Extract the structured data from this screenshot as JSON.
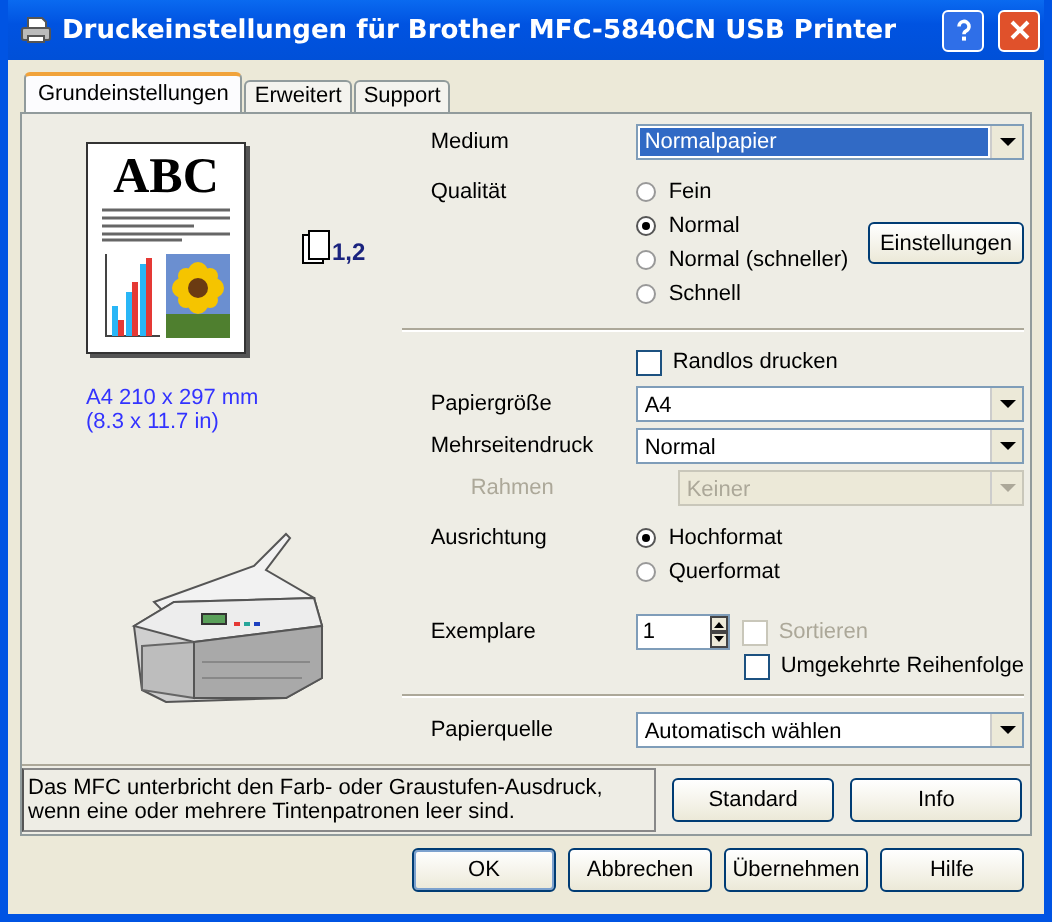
{
  "window": {
    "title": "Druckeinstellungen für Brother MFC-5840CN USB Printer"
  },
  "tabs": [
    {
      "label": "Grundeinstellungen",
      "selected": true
    },
    {
      "label": "Erweitert",
      "selected": false
    },
    {
      "label": "Support",
      "selected": false
    }
  ],
  "preview": {
    "heading": "ABC",
    "copies": "1,2",
    "paper_size": [
      "A4 210 x 297 mm",
      "(8.3 x 11.7 in)"
    ]
  },
  "settings": [
    {
      "kind": "dropdown",
      "label": "Medium",
      "value": "Normalpapier",
      "selected": true,
      "disabled": false
    },
    {
      "kind": "radios",
      "label": "Qualität",
      "options": [
        {
          "label": "Fein",
          "selected": false
        },
        {
          "label": "Normal",
          "selected": true
        },
        {
          "label": "Normal (schneller)",
          "selected": false
        },
        {
          "label": "Schnell",
          "selected": false
        }
      ],
      "button": "Einstellungen"
    },
    {
      "kind": "separator"
    },
    {
      "kind": "checkbox",
      "label": "Randlos drucken",
      "checked": false
    },
    {
      "kind": "dropdown",
      "label": "Papiergröße",
      "value": "A4",
      "selected": false,
      "disabled": false
    },
    {
      "kind": "dropdown",
      "label": "Mehrseitendruck",
      "value": "Normal",
      "selected": false,
      "disabled": false
    },
    {
      "kind": "dropdown",
      "label": "Rahmen",
      "value": "Keiner",
      "selected": false,
      "disabled": true
    },
    {
      "kind": "radios",
      "label": "Ausrichtung",
      "options": [
        {
          "label": "Hochformat",
          "selected": true
        },
        {
          "label": "Querformat",
          "selected": false
        }
      ]
    },
    {
      "kind": "copies",
      "label": "Exemplare",
      "value": "1",
      "sort": {
        "label": "Sortieren",
        "checked": false,
        "disabled": true
      },
      "reverse": {
        "label": "Umgekehrte Reihenfolge",
        "checked": false,
        "disabled": false
      }
    },
    {
      "kind": "separator"
    },
    {
      "kind": "dropdown",
      "label": "Papierquelle",
      "value": "Automatisch wählen",
      "selected": false,
      "disabled": false
    }
  ],
  "message": "Das MFC unterbricht den Farb- oder Graustufen-Ausdruck, wenn eine oder mehrere Tintenpatronen leer sind.",
  "panel_buttons": [
    "Standard",
    "Info"
  ],
  "dialog_buttons": [
    "OK",
    "Abbrechen",
    "Übernehmen",
    "Hilfe"
  ]
}
